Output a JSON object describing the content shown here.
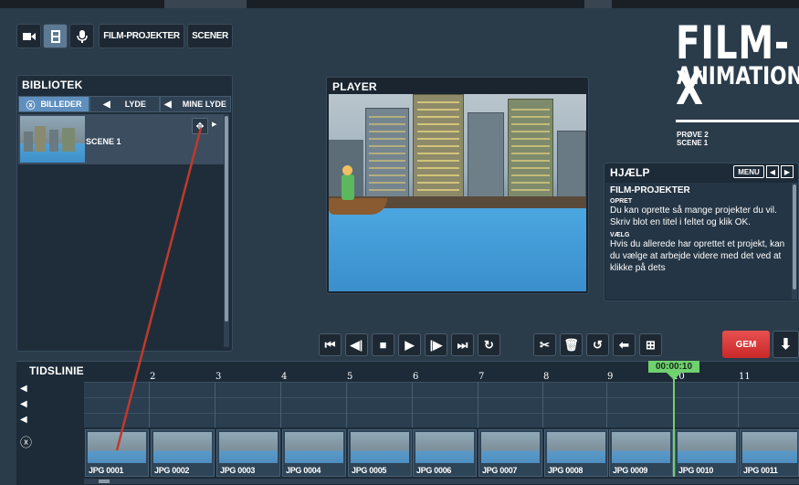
{
  "toolbar": {
    "film_projekter": "FILM-PROJEKTER",
    "scener": "SCENER"
  },
  "logo": {
    "line1": "FILM-X",
    "line2": "ANIMATION"
  },
  "project": {
    "name": "PRØVE 2",
    "scene": "SCENE 1"
  },
  "library": {
    "title": "BIBLIOTEK",
    "tabs": [
      "BILLEDER",
      "LYDE",
      "MINE LYDE"
    ],
    "items": [
      {
        "label": "SCENE 1"
      }
    ]
  },
  "player": {
    "title": "PLAYER"
  },
  "help": {
    "title": "HJÆLP",
    "menu_label": "MENU",
    "section": "FILM-PROJEKTER",
    "h1": "OPRET",
    "p1": "Du kan oprette så mange projekter du vil. Skriv blot en titel i feltet og klik OK.",
    "h2": "VÆLG",
    "p2": "Hvis du allerede har oprettet et projekt, kan du vælge at arbejde videre med det ved at klikke på dets"
  },
  "actions": {
    "gem": "GEM"
  },
  "timeline": {
    "title": "TIDSLINIE",
    "timecode": "00:00:10",
    "ticks": [
      "2",
      "3",
      "4",
      "5",
      "6",
      "7",
      "8",
      "9",
      "10",
      "11"
    ],
    "frames": [
      "JPG 0001",
      "JPG 0002",
      "JPG 0003",
      "JPG 0004",
      "JPG 0005",
      "JPG 0006",
      "JPG 0007",
      "JPG 0008",
      "JPG 0009",
      "JPG 0010",
      "JPG 0011"
    ]
  },
  "colors": {
    "background": "#2a3b4a",
    "panel": "#1f2d3a",
    "accent_blue": "#5e8fbe",
    "gem_red": "#d83a3a",
    "playhead_green": "#6ed26e",
    "drag_line": "#c0392b"
  }
}
